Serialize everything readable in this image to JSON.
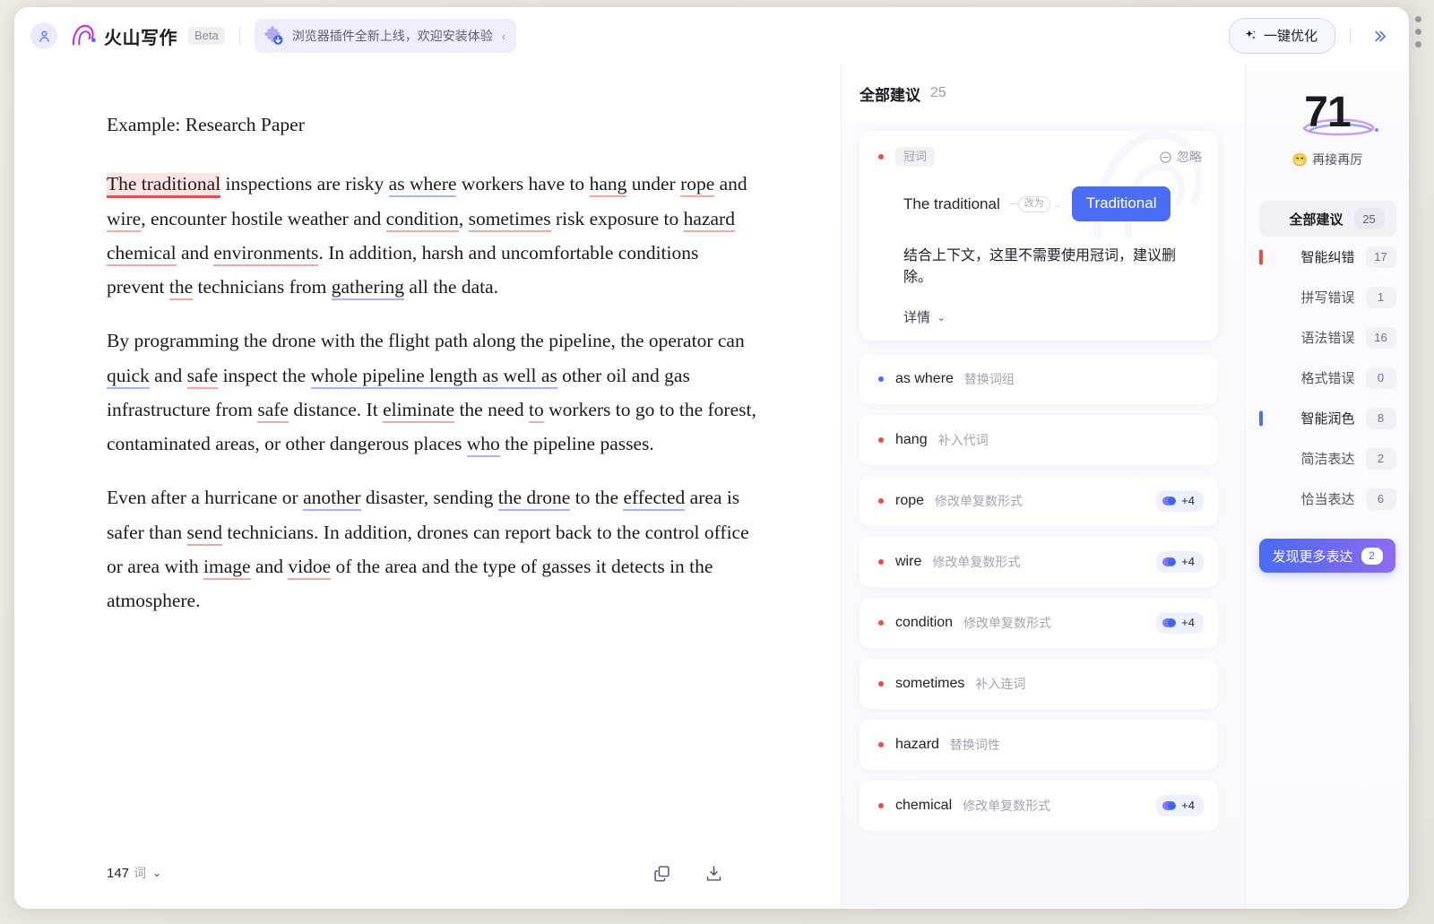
{
  "topbar": {
    "brand_name": "火山写作",
    "beta_label": "Beta",
    "promo_text": "浏览器插件全新上线，欢迎安装体验",
    "promo_chevron": "‹",
    "optimize_label": "一键优化",
    "collapse_label": "»"
  },
  "editor": {
    "title": "Example: Research Paper",
    "paragraphs": [
      {
        "runs": [
          {
            "t": "The traditional",
            "m": "hl-red"
          },
          {
            "t": " inspections are risky ",
            "m": ""
          },
          {
            "t": "as where",
            "m": "u-blue"
          },
          {
            "t": " workers have to ",
            "m": ""
          },
          {
            "t": "hang",
            "m": "u-red"
          },
          {
            "t": " under ",
            "m": ""
          },
          {
            "t": "rope",
            "m": "u-red"
          },
          {
            "t": " and ",
            "m": ""
          },
          {
            "t": "wire",
            "m": "u-red"
          },
          {
            "t": ", encounter hostile weather and ",
            "m": ""
          },
          {
            "t": "condition",
            "m": "u-red"
          },
          {
            "t": ", ",
            "m": ""
          },
          {
            "t": "sometimes",
            "m": "u-red"
          },
          {
            "t": " risk exposure to ",
            "m": ""
          },
          {
            "t": "hazard",
            "m": "u-red"
          },
          {
            "t": " ",
            "m": ""
          },
          {
            "t": "chemical",
            "m": "u-red"
          },
          {
            "t": " and ",
            "m": ""
          },
          {
            "t": "environments",
            "m": "u-red"
          },
          {
            "t": ". In addition, harsh and uncomfortable conditions prevent ",
            "m": ""
          },
          {
            "t": "the",
            "m": "u-red"
          },
          {
            "t": " technicians from ",
            "m": ""
          },
          {
            "t": "gathering",
            "m": "u-blue"
          },
          {
            "t": " all the data.",
            "m": ""
          }
        ]
      },
      {
        "runs": [
          {
            "t": "By programming the drone with the flight path along the pipeline, the operator can ",
            "m": ""
          },
          {
            "t": "quick",
            "m": "u-blue"
          },
          {
            "t": " and ",
            "m": ""
          },
          {
            "t": "safe",
            "m": "u-red"
          },
          {
            "t": " inspect the ",
            "m": ""
          },
          {
            "t": "whole pipeline length as well as",
            "m": "u-blue"
          },
          {
            "t": " other oil and gas infrastructure from ",
            "m": ""
          },
          {
            "t": "safe",
            "m": "u-red"
          },
          {
            "t": " distance. It ",
            "m": ""
          },
          {
            "t": "eliminate",
            "m": "u-red"
          },
          {
            "t": " the need ",
            "m": ""
          },
          {
            "t": "to",
            "m": "u-red"
          },
          {
            "t": " workers to go to the forest, contaminated areas, or other dangerous places ",
            "m": ""
          },
          {
            "t": "who",
            "m": "u-blue"
          },
          {
            "t": " the pipeline passes.",
            "m": ""
          }
        ]
      },
      {
        "runs": [
          {
            "t": "Even after a hurricane or ",
            "m": ""
          },
          {
            "t": "another",
            "m": "u-blue"
          },
          {
            "t": " disaster, sending ",
            "m": ""
          },
          {
            "t": "the drone",
            "m": "u-blue"
          },
          {
            "t": " to the ",
            "m": ""
          },
          {
            "t": "effected",
            "m": "u-blue"
          },
          {
            "t": " area is safer than ",
            "m": ""
          },
          {
            "t": "send",
            "m": "u-red"
          },
          {
            "t": " technicians. In addition, drones can report back to the control office or area with ",
            "m": ""
          },
          {
            "t": "image",
            "m": "u-red"
          },
          {
            "t": " and ",
            "m": ""
          },
          {
            "t": "vidoe",
            "m": "u-red"
          },
          {
            "t": " of the area and the type of gasses it detects in the atmosphere.",
            "m": ""
          }
        ]
      }
    ],
    "word_count": "147",
    "word_unit": "词",
    "word_chevron": "⌄",
    "copy_icon": "copy-icon",
    "download_icon": "download-icon"
  },
  "suggestions": {
    "header_title": "全部建议",
    "header_count": "25",
    "main_card": {
      "dot_color": "red",
      "tag": "冠词",
      "ignore_label": "忽略",
      "original": "The traditional",
      "arrow_label": "改为",
      "replacement": "Traditional",
      "explanation": "结合上下文，这里不需要使用冠词，建议删除。",
      "detail_label": "详情",
      "detail_chevron": "⌄"
    },
    "items": [
      {
        "dot": "blue",
        "word": "as where",
        "kind": "替换词组",
        "badge": null
      },
      {
        "dot": "red",
        "word": "hang",
        "kind": "补入代词",
        "badge": null
      },
      {
        "dot": "red",
        "word": "rope",
        "kind": "修改单复数形式",
        "badge": "+4"
      },
      {
        "dot": "red",
        "word": "wire",
        "kind": "修改单复数形式",
        "badge": "+4"
      },
      {
        "dot": "red",
        "word": "condition",
        "kind": "修改单复数形式",
        "badge": "+4"
      },
      {
        "dot": "red",
        "word": "sometimes",
        "kind": "补入连词",
        "badge": null
      },
      {
        "dot": "red",
        "word": "hazard",
        "kind": "替换词性",
        "badge": null
      },
      {
        "dot": "red",
        "word": "chemical",
        "kind": "修改单复数形式",
        "badge": "+4"
      }
    ]
  },
  "rail": {
    "score": "71",
    "score_emoji": "😁",
    "score_label": "再接再厉",
    "all_label": "全部建议",
    "all_count": "25",
    "categories": [
      {
        "label": "智能纠错",
        "count": "17",
        "bar": "#ef4b45",
        "level": "group"
      },
      {
        "label": "拼写错误",
        "count": "1",
        "bar": null,
        "level": "sub"
      },
      {
        "label": "语法错误",
        "count": "16",
        "bar": null,
        "level": "sub"
      },
      {
        "label": "格式错误",
        "count": "0",
        "bar": null,
        "level": "sub"
      },
      {
        "label": "智能润色",
        "count": "8",
        "bar": "#4b6ef5",
        "level": "group"
      },
      {
        "label": "简洁表达",
        "count": "2",
        "bar": null,
        "level": "sub"
      },
      {
        "label": "恰当表达",
        "count": "6",
        "bar": null,
        "level": "sub"
      }
    ],
    "more_label": "发现更多表达",
    "more_count": "2"
  },
  "colors": {
    "accent": "#4b6ef5",
    "error": "#e8504b",
    "error_underline": "#f4a8a5",
    "polish_underline": "#a9b6f2"
  }
}
